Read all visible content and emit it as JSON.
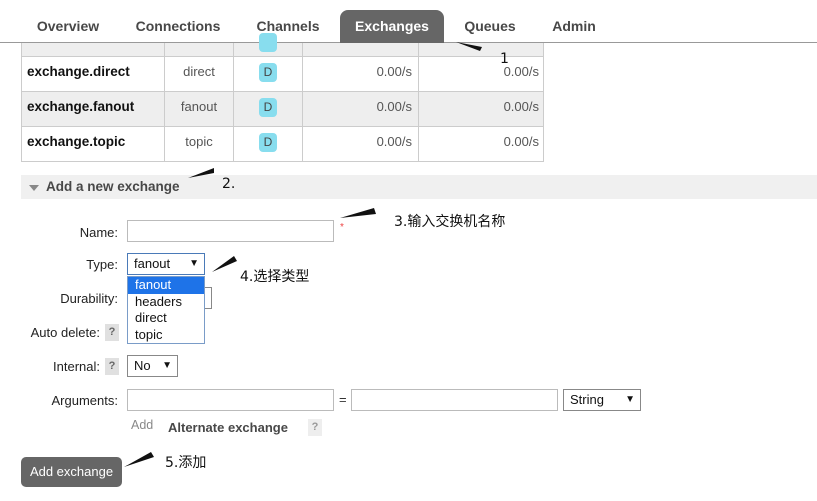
{
  "nav": {
    "tabs": [
      "Overview",
      "Connections",
      "Channels",
      "Exchanges",
      "Queues",
      "Admin"
    ],
    "active_tab": "Exchanges"
  },
  "exchanges": [
    {
      "name": "exchange.direct",
      "type": "direct",
      "features": "D",
      "rate_in": "0.00/s",
      "rate_out": "0.00/s"
    },
    {
      "name": "exchange.fanout",
      "type": "fanout",
      "features": "D",
      "rate_in": "0.00/s",
      "rate_out": "0.00/s"
    },
    {
      "name": "exchange.topic",
      "type": "topic",
      "features": "D",
      "rate_in": "0.00/s",
      "rate_out": "0.00/s"
    }
  ],
  "add_section": {
    "title": "Add a new exchange",
    "labels": {
      "name": "Name:",
      "type": "Type:",
      "durability": "Durability:",
      "auto_delete": "Auto delete:",
      "internal": "Internal:",
      "arguments": "Arguments:"
    },
    "required_mark": "*",
    "help": "?",
    "name_value": "",
    "type_value": "fanout",
    "type_options": [
      "fanout",
      "headers",
      "direct",
      "topic"
    ],
    "internal_value": "No",
    "arg_value_type": "String",
    "equals": "=",
    "add_link": "Add",
    "alternate_exchange": "Alternate exchange",
    "submit_label": "Add exchange"
  },
  "annotations": {
    "a1": "1",
    "a2": "2.",
    "a3": "3.输入交换机名称",
    "a4": "4.选择类型",
    "a5": "5.添加"
  },
  "colors": {
    "active_tab": "#666666",
    "badge": "#88ddee",
    "button": "#666666",
    "selected_option": "#1e73e8"
  }
}
